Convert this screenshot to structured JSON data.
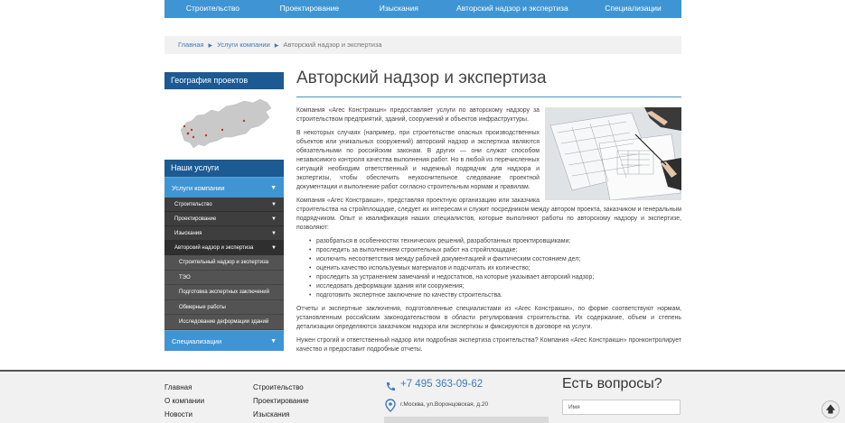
{
  "topnav": [
    "Строительство",
    "Проектирование",
    "Изыскания",
    "Авторский надзор и экспертиза",
    "Специализации"
  ],
  "breadcrumb": {
    "home": "Главная",
    "services": "Услуги компании",
    "current": "Авторский надзор и экспертиза"
  },
  "sidebar": {
    "geo_title": "География проектов",
    "services_title": "Наши услуги",
    "menu": {
      "company_services": "Услуги компании",
      "construction": "Строительство",
      "design": "Проектирование",
      "surveys": "Изыскания",
      "supervision": "Авторский надзор и экспертиза",
      "sub": [
        "Строительный надзор и экспертиза",
        "ТЭО",
        "Подготовка экспертных заключений",
        "Обмерные работы",
        "Исследование деформации зданий"
      ],
      "specializations": "Специализации"
    }
  },
  "page": {
    "title": "Авторский надзор и экспертиза",
    "p1": "Компания «Агес Констракшн» предоставляет услуги по авторскому надзору за строительством предприятий, зданий, сооружений и объектов инфраструктуры.",
    "p2": "В некоторых случаях (например, при строительстве опасных производственных объектов или уникальных сооружений) авторский надзор и экспертиза являются обязательными по российским законам. В других — они служат способом независимого контроля качества выполнения работ. Но в любой из перечисленных ситуаций необходим ответственный и надежный подрядчик для надзора и экспертизы, чтобы обеспечить неукоснительное следование проектной документации и выполнение работ согласно строительным нормам и правилам.",
    "p3": "Компания «Агес Констракшн», представляя проектную организацию или заказчика строительства на стройплощадке, следует их интересам и служит посредником между автором проекта, заказчиком и генеральным подрядчиком. Опыт и квалификация наших специалистов, которые выполняют работы по авторскому надзору и экспертизе, позволяют:",
    "bullets": [
      "разобраться в особенностях технических решений, разработанных проектировщиками;",
      "проследить за выполнением строительных работ на стройплощадке;",
      "исключить несоответствия между рабочей документацией и фактическим состоянием дел;",
      "оценить качество используемых материалов и подсчитать их количество;",
      "проследить за устранением замечаний и недостатков, на которые указывает авторский надзор;",
      "исследовать деформации здания или сооружения;",
      "подготовить экспертное заключение по качеству строительства."
    ],
    "p4": "Отчеты и экспертные заключения, подготовленные специалистами из «Агес Констракшн», по форме соответствуют нормам, установленным российским законодательством в области регулирования строительства. Их содержание, объем и степень детализации определяются заказчиком надзора или экспертизы и фиксируются в договоре на услуги.",
    "p5": "Нужен строгий и ответственный надзор или подробная экспертиза строительства? Компания «Агес Констракшн» пронконтролирует качество и предоставит подробные отчеты."
  },
  "footer": {
    "col1": [
      "Главная",
      "О компании",
      "Новости"
    ],
    "col2": [
      "Строительство",
      "Проектирование",
      "Изыскания"
    ],
    "phone": "+7 495 363-09-62",
    "address": "г.Москва, ул.Воронцовская, д.20",
    "question": "Есть вопросы?",
    "name_placeholder": "Имя"
  },
  "colors": {
    "accent": "#3f95d4",
    "dark_blue": "#1c5a94",
    "menu_dark": "#3e3e3e"
  },
  "icons": [
    "phone-icon",
    "location-pin-icon",
    "arrow-up-icon",
    "chevron-down-icon"
  ]
}
